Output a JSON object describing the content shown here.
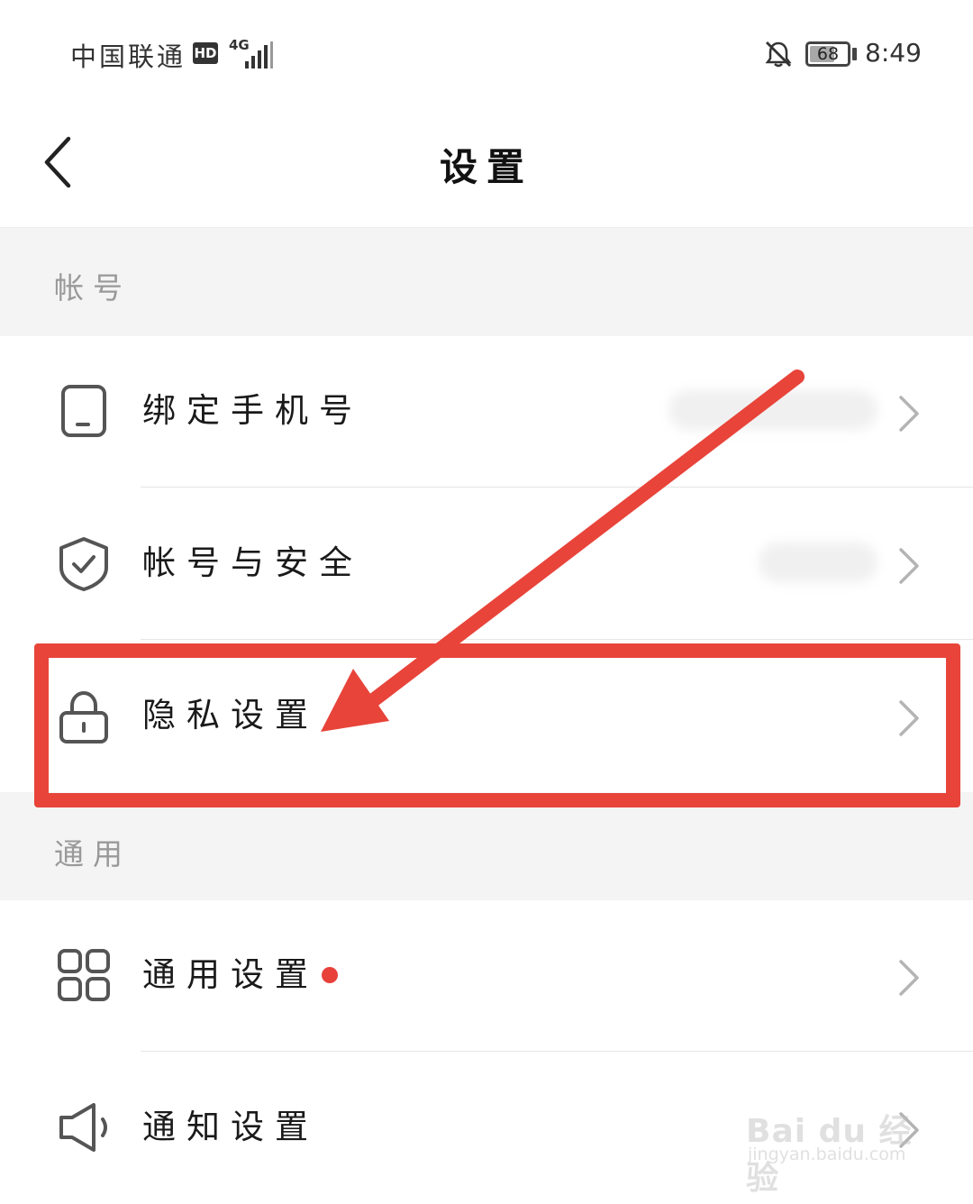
{
  "status_bar": {
    "carrier": "中国联通",
    "hd_badge": "HD",
    "network": "4G",
    "battery": "68",
    "battery_level": 0.68,
    "time": "8:49"
  },
  "header": {
    "title": "设置",
    "back_icon": "chevron-left-icon"
  },
  "sections": [
    {
      "label": "帐号",
      "rows": [
        {
          "label": "绑定手机号",
          "icon": "phone-icon",
          "value": "",
          "value_blurred": true
        },
        {
          "label": "帐号与安全",
          "icon": "shield-check-icon",
          "value": "",
          "value_blurred": true
        },
        {
          "label": "隐私设置",
          "icon": "lock-icon",
          "highlighted": true
        }
      ]
    },
    {
      "label": "通用",
      "rows": [
        {
          "label": "通用设置",
          "icon": "grid-icon",
          "badge_dot": true
        },
        {
          "label": "通知设置",
          "icon": "speaker-icon"
        }
      ]
    }
  ],
  "annotation": {
    "highlight_color": "#e8443a",
    "arrow": "pointing to 隐私设置"
  },
  "watermark": {
    "main": "Bai du 经验",
    "sub": "jingyan.baidu.com"
  }
}
